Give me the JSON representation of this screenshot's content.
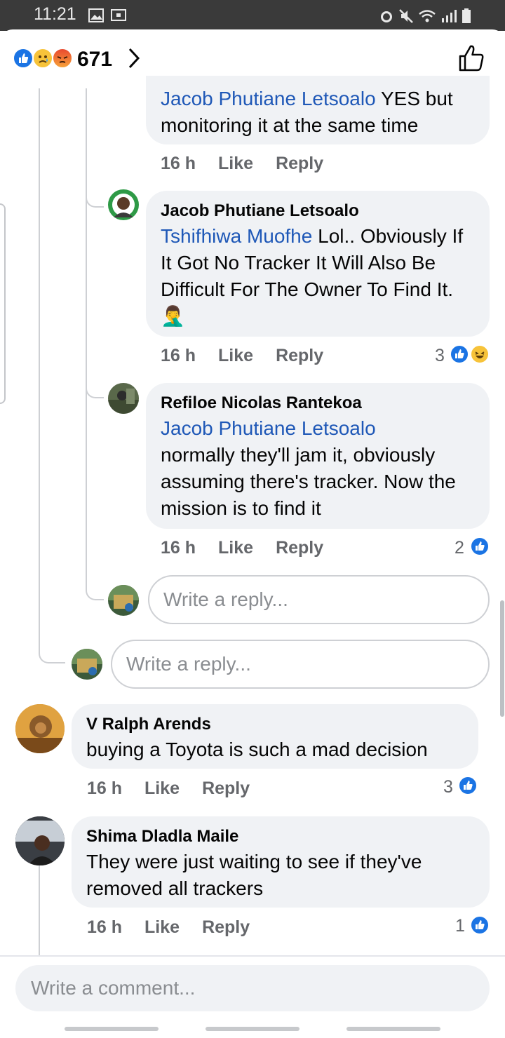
{
  "status": {
    "time": "11:21"
  },
  "header": {
    "reaction_count": "671"
  },
  "comments": [
    {
      "author": "",
      "mention": "Jacob Phutiane Letsoalo",
      "text": " YES but monitoring it at the same time",
      "time": "16 h",
      "like": "Like",
      "reply": "Reply"
    },
    {
      "author": "Jacob Phutiane Letsoalo",
      "mention": "Tshifhiwa Muofhe",
      "text": " Lol.. Obviously If It Got No Tracker It Will Also Be Difficult For The Owner To Find It.",
      "emoji": "🤦‍♂️",
      "time": "16 h",
      "like": "Like",
      "reply": "Reply",
      "reaction_count": "3"
    },
    {
      "author": "Refiloe Nicolas Rantekoa",
      "mention": "Jacob Phutiane Letsoalo",
      "text": "normally they'll jam it, obviously assuming there's tracker. Now the mission is to find it",
      "time": "16 h",
      "like": "Like",
      "reply": "Reply",
      "reaction_count": "2"
    },
    {
      "author": "V Ralph Arends",
      "text": "buying a Toyota is such a mad decision",
      "time": "16 h",
      "like": "Like",
      "reply": "Reply",
      "reaction_count": "3"
    },
    {
      "author": "Shima Dladla Maile",
      "text": "They were just waiting to see if they've removed all trackers",
      "time": "16 h",
      "like": "Like",
      "reply": "Reply",
      "reaction_count": "1"
    }
  ],
  "reply_placeholder": "Write a reply...",
  "comment_placeholder": "Write a comment...",
  "colors": {
    "like_blue": "#1b74e4",
    "mention_blue": "#1f58b7",
    "bubble_bg": "#f0f2f5",
    "meta_gray": "#65676b"
  },
  "icons": [
    "like-icon",
    "sad-icon",
    "angry-icon",
    "chevron-right-icon",
    "thumbs-up-icon",
    "haha-icon",
    "facepalm-emoji"
  ]
}
